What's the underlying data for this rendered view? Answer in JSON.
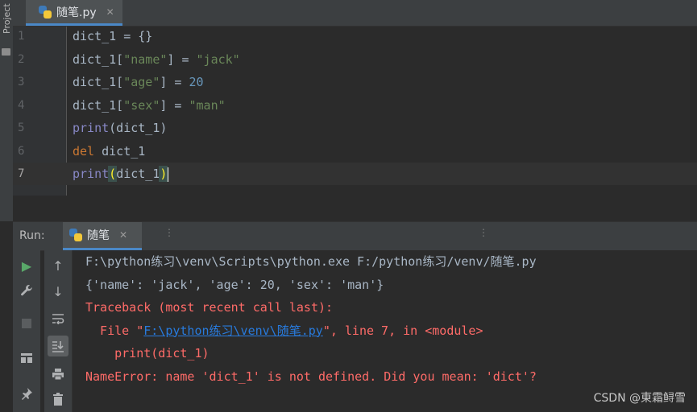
{
  "sidebar": {
    "project_label": "Project"
  },
  "editor_tab": {
    "label": "随笔.py",
    "close": "✕"
  },
  "editor": {
    "current_line": 7,
    "lines": [
      {
        "num": "1",
        "parts": [
          {
            "t": "dict_1 = {}",
            "c": ""
          }
        ]
      },
      {
        "num": "2",
        "parts": [
          {
            "t": "dict_1[",
            "c": ""
          },
          {
            "t": "\"name\"",
            "c": "str"
          },
          {
            "t": "] = ",
            "c": ""
          },
          {
            "t": "\"jack\"",
            "c": "str"
          }
        ]
      },
      {
        "num": "3",
        "parts": [
          {
            "t": "dict_1[",
            "c": ""
          },
          {
            "t": "\"age\"",
            "c": "str"
          },
          {
            "t": "] = ",
            "c": ""
          },
          {
            "t": "20",
            "c": "num"
          }
        ]
      },
      {
        "num": "4",
        "parts": [
          {
            "t": "dict_1[",
            "c": ""
          },
          {
            "t": "\"sex\"",
            "c": "str"
          },
          {
            "t": "] = ",
            "c": ""
          },
          {
            "t": "\"man\"",
            "c": "str"
          }
        ]
      },
      {
        "num": "5",
        "parts": [
          {
            "t": "print",
            "c": "kw-fn"
          },
          {
            "t": "(dict_1)",
            "c": ""
          }
        ]
      },
      {
        "num": "6",
        "parts": [
          {
            "t": "del",
            "c": "kw"
          },
          {
            "t": " dict_1",
            "c": ""
          }
        ]
      },
      {
        "num": "7",
        "parts": [
          {
            "t": "print",
            "c": "kw-fn"
          },
          {
            "t": "(",
            "c": "brk"
          },
          {
            "t": "dict_1",
            "c": ""
          },
          {
            "t": ")",
            "c": "brk"
          }
        ]
      }
    ]
  },
  "run_panel": {
    "label": "Run:",
    "tab_label": "随笔",
    "tab_close": "✕",
    "dots": "⋮",
    "icons_col1": [
      "run-icon",
      "wrench-icon",
      "stop-icon",
      "layout-icon",
      "pin-icon"
    ],
    "icons_col2": [
      "arrow-up-icon",
      "arrow-down-icon",
      "soft-wrap-icon",
      "scroll-to-end-icon",
      "print-icon",
      "trash-icon"
    ]
  },
  "console": {
    "lines": [
      {
        "cls": "c-norm",
        "parts": [
          {
            "t": "F:\\python练习\\venv\\Scripts\\python.exe F:/python练习/venv/随笔.py",
            "link": false
          }
        ]
      },
      {
        "cls": "c-norm",
        "parts": [
          {
            "t": "{'name': 'jack', 'age': 20, 'sex': 'man'}",
            "link": false
          }
        ]
      },
      {
        "cls": "c-err",
        "parts": [
          {
            "t": "Traceback (most recent call last):",
            "link": false
          }
        ]
      },
      {
        "cls": "c-err",
        "parts": [
          {
            "t": "  File \"",
            "link": false
          },
          {
            "t": "F:\\python练习\\venv\\随笔.py",
            "link": true
          },
          {
            "t": "\", line 7, in <module>",
            "link": false
          }
        ]
      },
      {
        "cls": "c-err",
        "parts": [
          {
            "t": "    print(dict_1)",
            "link": false
          }
        ]
      },
      {
        "cls": "c-err",
        "parts": [
          {
            "t": "NameError: name 'dict_1' is not defined. Did you mean: 'dict'?",
            "link": false
          }
        ]
      }
    ]
  },
  "watermark": "CSDN @東霜鲟雪",
  "colors": {
    "background": "#2b2b2b",
    "error": "#ff6b68",
    "link": "#287bde",
    "accent": "#4a88c7"
  }
}
